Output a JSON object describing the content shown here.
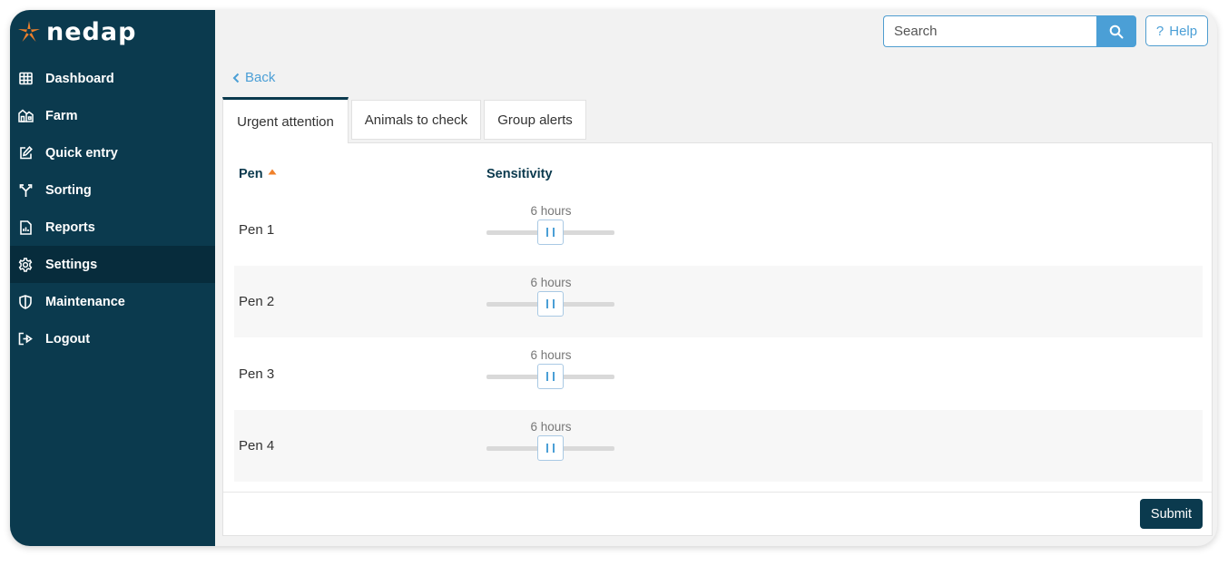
{
  "brand": {
    "name": "nedap",
    "star_color": "#f0812b",
    "sidebar_color": "#0b3a4e",
    "accent": "#4b9fd6"
  },
  "sidebar": {
    "items": [
      {
        "label": "Dashboard",
        "icon": "grid-icon",
        "active": false
      },
      {
        "label": "Farm",
        "icon": "farm-icon",
        "active": false
      },
      {
        "label": "Quick entry",
        "icon": "edit-icon",
        "active": false
      },
      {
        "label": "Sorting",
        "icon": "fork-icon",
        "active": false
      },
      {
        "label": "Reports",
        "icon": "report-icon",
        "active": false
      },
      {
        "label": "Settings",
        "icon": "gear-icon",
        "active": true
      },
      {
        "label": "Maintenance",
        "icon": "shield-icon",
        "active": false
      },
      {
        "label": "Logout",
        "icon": "logout-icon",
        "active": false
      }
    ]
  },
  "header": {
    "search_placeholder": "Search",
    "help_label": "Help",
    "help_icon_glyph": "?"
  },
  "back": {
    "label": "Back"
  },
  "tabs": [
    {
      "label": "Urgent attention",
      "active": true
    },
    {
      "label": "Animals to check",
      "active": false
    },
    {
      "label": "Group alerts",
      "active": false
    }
  ],
  "table": {
    "columns": {
      "pen": "Pen",
      "sensitivity": "Sensitivity"
    },
    "sort": {
      "column": "Pen",
      "direction": "ascending",
      "color": "#f0812b"
    },
    "rows": [
      {
        "pen": "Pen 1",
        "value": "6 hours"
      },
      {
        "pen": "Pen 2",
        "value": "6 hours"
      },
      {
        "pen": "Pen 3",
        "value": "6 hours"
      },
      {
        "pen": "Pen 4",
        "value": "6 hours"
      }
    ]
  },
  "footer": {
    "submit_label": "Submit"
  }
}
